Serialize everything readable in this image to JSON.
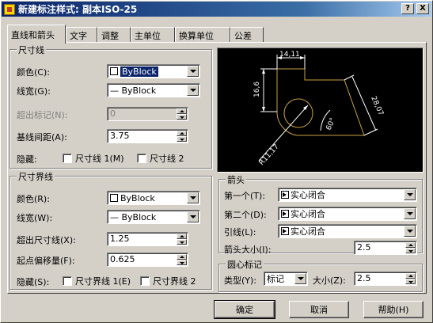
{
  "window": {
    "title": "新建标注样式: 副本ISO-25",
    "help_btn": "?",
    "close_btn": "X"
  },
  "tabs": [
    "直线和箭头",
    "文字",
    "调整",
    "主单位",
    "换算单位",
    "公差"
  ],
  "dimension_lines": {
    "title": "尺寸线",
    "color_label": "颜色(C):",
    "color_value": "ByBlock",
    "lineweight_label": "线宽(G):",
    "lineweight_value": "— ByBlock",
    "extend_label": "超出标记(N):",
    "extend_value": "0",
    "baseline_label": "基线间距(A):",
    "baseline_value": "3.75",
    "suppress_label": "隐藏:",
    "suppress_1": "尺寸线 1(M)",
    "suppress_2": "尺寸线 2"
  },
  "extension_lines": {
    "title": "尺寸界线",
    "color_label": "颜色(R):",
    "color_value": "ByBlock",
    "lineweight_label": "线宽(W):",
    "lineweight_value": "— ByBlock",
    "extend_label": "超出尺寸线(X):",
    "extend_value": "1.25",
    "offset_label": "起点偏移量(F):",
    "offset_value": "0.625",
    "suppress_label": "隐藏(S):",
    "suppress_1": "尺寸界线 1(E)",
    "suppress_2": "尺寸界线 2"
  },
  "preview": {
    "dim_top": "14,11",
    "dim_left": "16,6",
    "dim_right": "28,07",
    "dim_angle": "60°",
    "dim_radius": "R11,17",
    "colors": {
      "geometry": "#c8a040",
      "dims": "#ffffff"
    }
  },
  "arrowheads": {
    "title": "箭头",
    "first_label": "第一个(T):",
    "first_value": "实心闭合",
    "second_label": "第二个(D):",
    "second_value": "实心闭合",
    "leader_label": "引线(L):",
    "leader_value": "实心闭合",
    "size_label": "箭头大小(I):",
    "size_value": "2.5"
  },
  "center_marks": {
    "title": "圆心标记",
    "type_label": "类型(Y):",
    "type_value": "标记",
    "size_label": "大小(Z):",
    "size_value": "2.5"
  },
  "buttons": {
    "ok": "确定",
    "cancel": "取消",
    "help": "帮助(H)"
  }
}
